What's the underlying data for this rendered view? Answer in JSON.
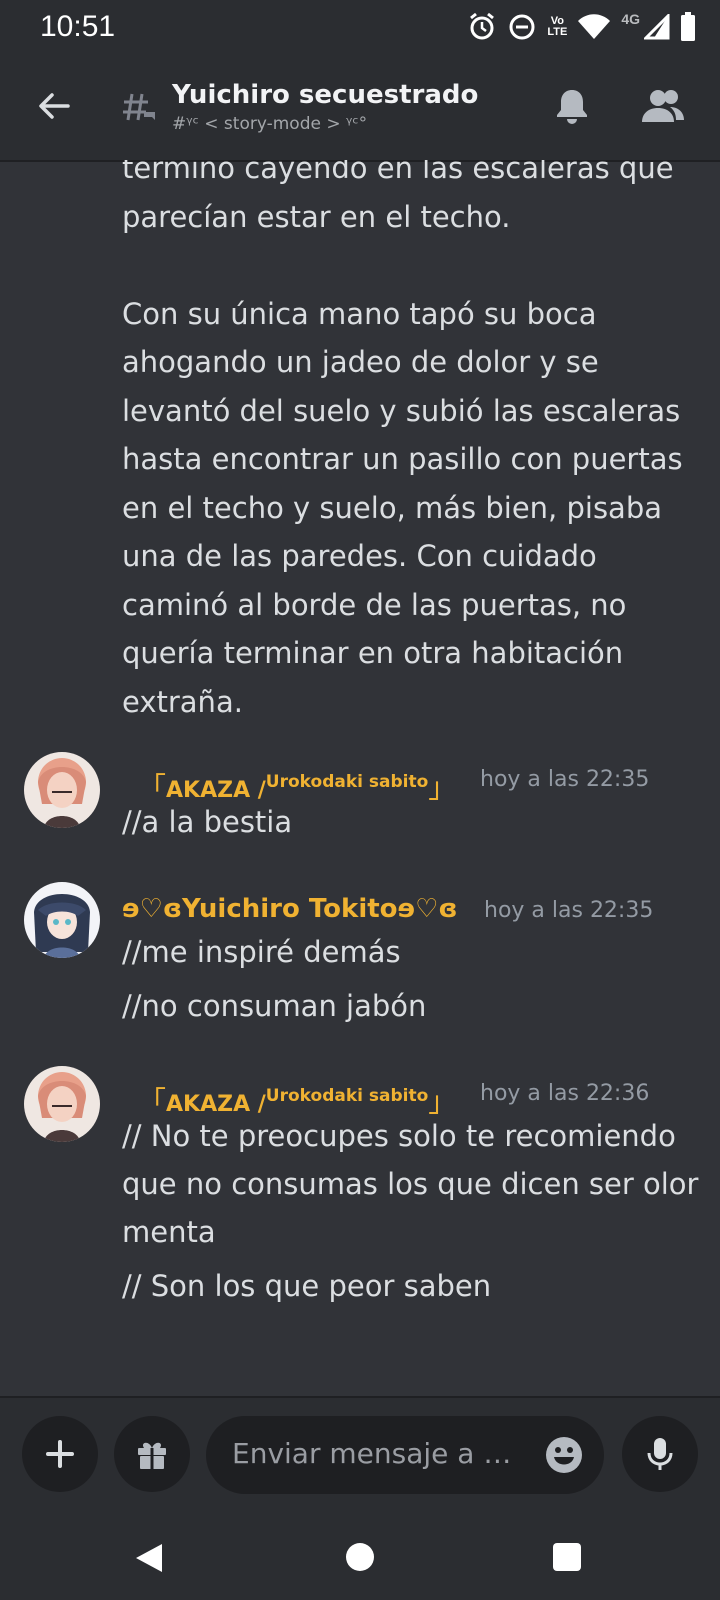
{
  "status_bar": {
    "time": "10:51",
    "volte_top": "Vo",
    "volte_bottom": "LTE",
    "network": "4G",
    "icons": [
      "alarm-icon",
      "do-not-disturb-icon",
      "volte-icon",
      "wifi-icon",
      "signal-icon",
      "battery-icon"
    ]
  },
  "header": {
    "title": "Yuichiro secuestrado",
    "topic": "#ᵞᶜ < story-mode > ᵞᶜ°",
    "icons": [
      "back-arrow-icon",
      "thread-hash-icon",
      "bell-icon",
      "members-icon"
    ]
  },
  "messages": {
    "story_text": "terminó cayendo en las escaleras que parecían estar en el techo.\n\nCon su única mano tapó su boca ahogando un jadeo de dolor y se levantó del suelo y subió las escaleras hasta encontrar un pasillo con puertas en el techo y suelo, más bien, pisaba una de las paredes. Con cuidado caminó al borde de las puertas, no quería terminar en otra habitación extraña.",
    "groups": [
      {
        "author_open": "「",
        "author_main": "AKAZA /",
        "author_small": "Urokodaki sabito",
        "author_close": "」",
        "time": "hoy a las 22:35",
        "lines": [
          "//a la bestia"
        ]
      },
      {
        "author": "ɘ♡ɞYuichiro Tokitoɘ♡ɞ",
        "time": "hoy a las 22:35",
        "lines": [
          "//me inspiré demás",
          "//no consuman jabón"
        ]
      },
      {
        "author_open": "「",
        "author_main": "AKAZA /",
        "author_small": "Urokodaki sabito",
        "author_close": "」",
        "time": "hoy a las 22:36",
        "lines": [
          "// No te preocupes solo te recomiendo que no consumas los que dicen ser olor menta",
          "// Son los que peor saben"
        ]
      }
    ]
  },
  "composer": {
    "placeholder": "Enviar mensaje a …",
    "icons": [
      "plus-icon",
      "gift-icon",
      "emoji-icon",
      "microphone-icon"
    ]
  },
  "nav_bar": {
    "icons": [
      "nav-back-icon",
      "nav-home-icon",
      "nav-recents-icon"
    ]
  },
  "colors": {
    "background": "#313338",
    "header": "#2b2d31",
    "author": "#f0b232",
    "text": "#dbdee1",
    "muted": "#949ba4"
  }
}
